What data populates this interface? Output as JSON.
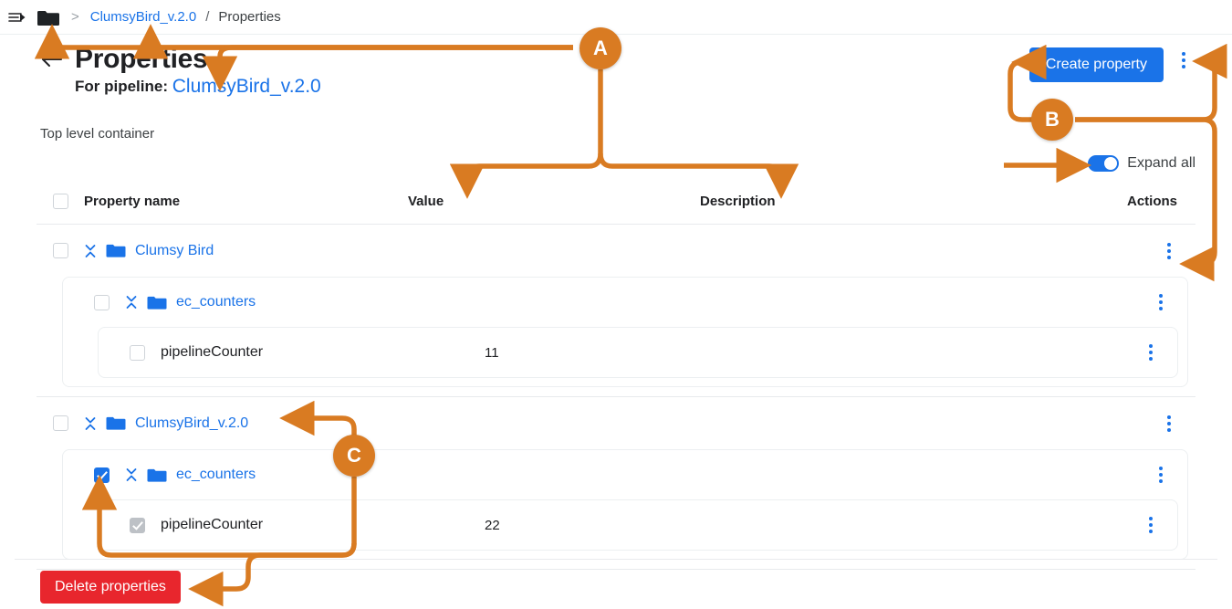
{
  "breadcrumb": {
    "menu_icon": "menu-arrow-icon",
    "folder_icon": "folder-icon",
    "separator": ">",
    "link": "ClumsyBird_v.2.0",
    "slash": "/",
    "current": "Properties"
  },
  "header": {
    "back_icon": "back-arrow-icon",
    "title": "Properties",
    "subtitle_label": "For pipeline:",
    "subtitle_link": "ClumsyBird_v.2.0",
    "create_button": "Create property",
    "overflow_icon": "kebab-menu-icon"
  },
  "container_label": "Top level container",
  "expand_all": {
    "label": "Expand all",
    "state": "on"
  },
  "table": {
    "columns": [
      "Property name",
      "Value",
      "Description",
      "Actions"
    ],
    "rows": [
      {
        "name": "Clumsy Bird",
        "value": "",
        "description": "",
        "type": "folder",
        "checked": false,
        "level": 0,
        "children": [
          {
            "name": "ec_counters",
            "value": "",
            "description": "",
            "type": "folder",
            "checked": false,
            "level": 1,
            "children": [
              {
                "name": "pipelineCounter",
                "value": "11",
                "description": "",
                "type": "leaf",
                "checked": false,
                "level": 2
              }
            ]
          }
        ]
      },
      {
        "name": "ClumsyBird_v.2.0",
        "value": "",
        "description": "",
        "type": "folder",
        "checked": false,
        "level": 0,
        "children": [
          {
            "name": "ec_counters",
            "value": "",
            "description": "",
            "type": "folder",
            "checked": true,
            "level": 1,
            "children": [
              {
                "name": "pipelineCounter",
                "value": "22",
                "description": "",
                "type": "leaf",
                "checked": true,
                "disabled": true,
                "level": 2
              }
            ]
          }
        ]
      }
    ]
  },
  "footer": {
    "delete_button": "Delete properties"
  },
  "annotations": {
    "color": "#d97b22",
    "badges": [
      {
        "id": "A",
        "label": "A"
      },
      {
        "id": "B",
        "label": "B"
      },
      {
        "id": "C",
        "label": "C"
      }
    ]
  },
  "colors": {
    "accent_blue": "#1a73e8",
    "danger_red": "#e8262d",
    "annotation_orange": "#d97b22",
    "text_primary": "#202124",
    "text_secondary": "#5f6368",
    "border": "#e8eaed"
  }
}
